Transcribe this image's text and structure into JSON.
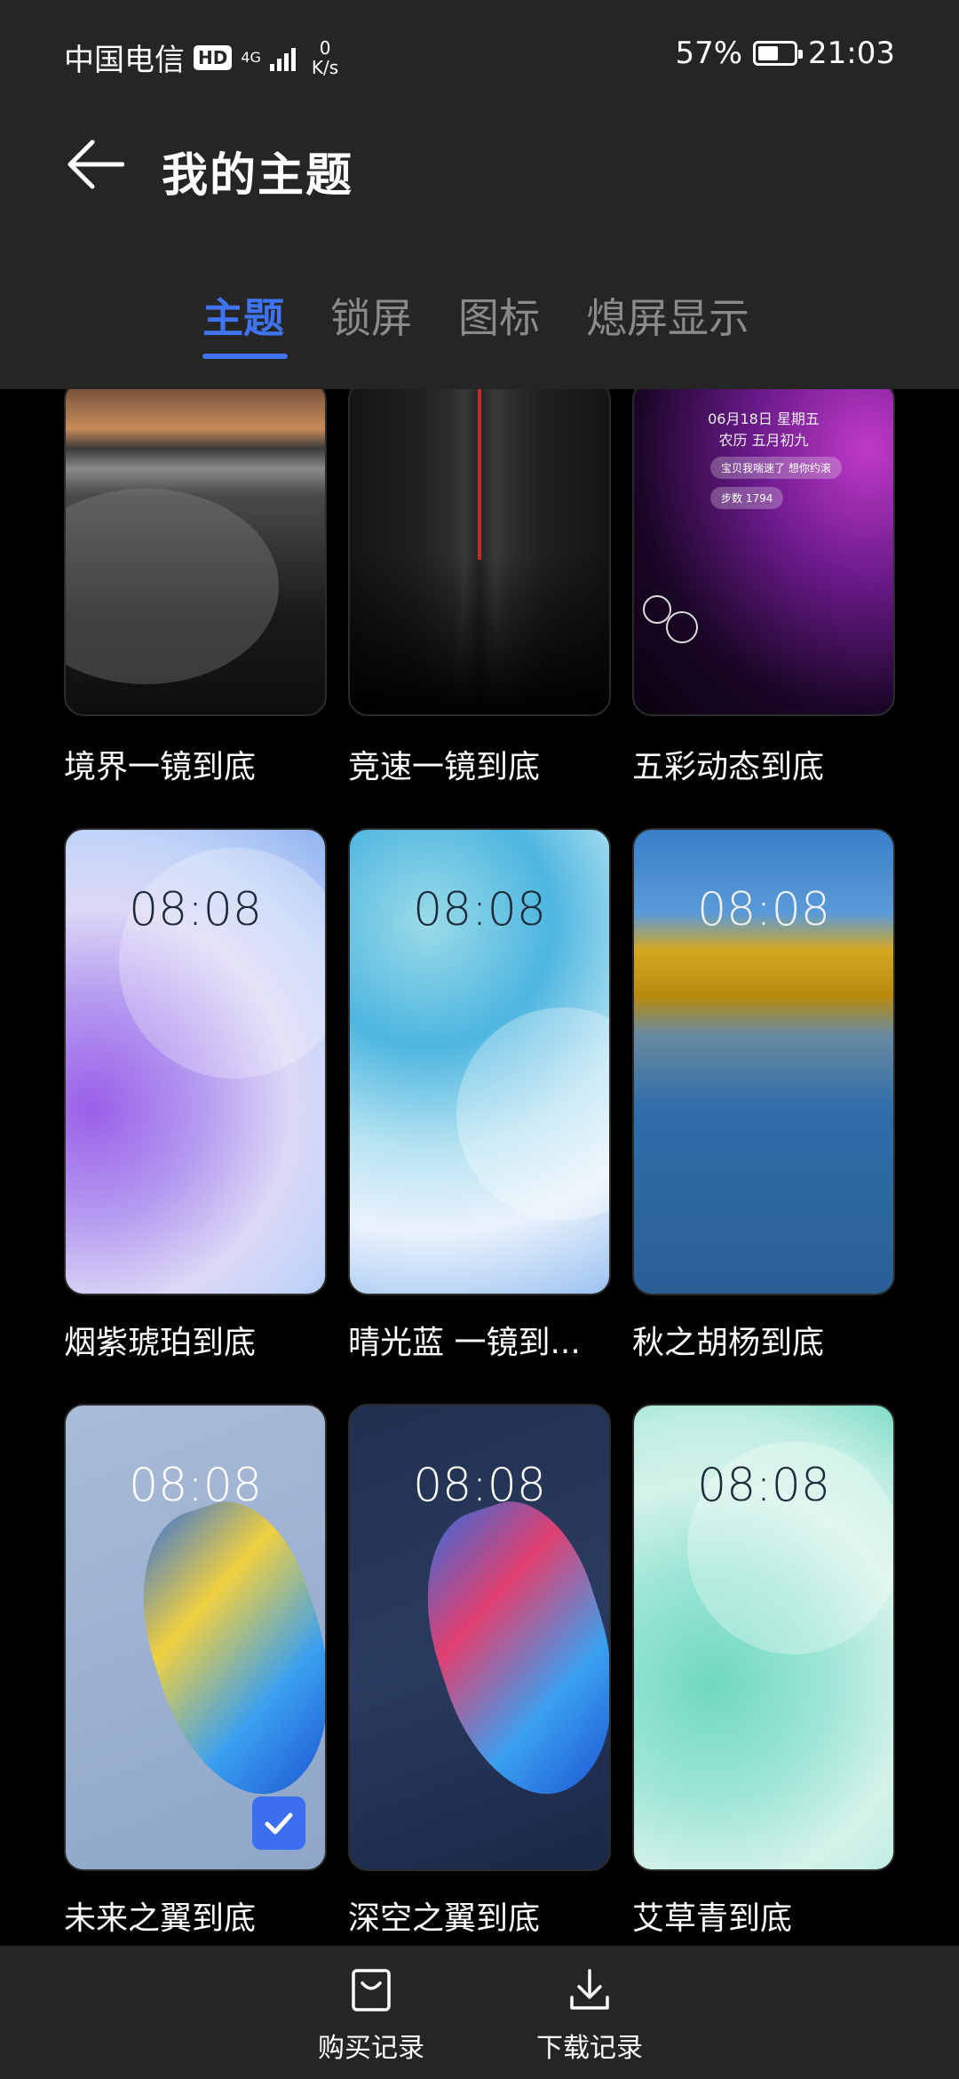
{
  "status_bar": {
    "carrier": "中国电信",
    "hd": "HD",
    "network": "4G",
    "speed_value": "0",
    "speed_unit": "K/s",
    "battery_percent": "57%",
    "battery_level": 0.57,
    "time": "21:03"
  },
  "header": {
    "back_icon": "arrow-left-icon",
    "title": "我的主题"
  },
  "tabs": [
    {
      "label": "主题",
      "active": true
    },
    {
      "label": "锁屏",
      "active": false
    },
    {
      "label": "图标",
      "active": false
    },
    {
      "label": "熄屏显示",
      "active": false
    }
  ],
  "themes": [
    {
      "name": "境界一镜到底",
      "clock": ""
    },
    {
      "name": "竞速一镜到底",
      "clock": ""
    },
    {
      "name": "五彩动态到底",
      "clock": "",
      "preview_date": "06月18日 星期五",
      "preview_lunar": "农历 五月初九",
      "preview_bubble1": "宝贝我喘速了 想你约滚",
      "preview_bubble2": "步数 1794"
    },
    {
      "name": "烟紫琥珀到底",
      "clock": "08:08"
    },
    {
      "name": "晴光蓝 一镜到...",
      "clock": "08:08"
    },
    {
      "name": "秋之胡杨到底",
      "clock": "08:08"
    },
    {
      "name": "未来之翼到底",
      "clock": "08:08",
      "selected": true
    },
    {
      "name": "深空之翼到底",
      "clock": "08:08"
    },
    {
      "name": "艾草青到底",
      "clock": "08:08"
    }
  ],
  "bottom_bar": {
    "purchase_label": "购买记录",
    "purchase_icon": "shopping-bag-icon",
    "download_label": "下载记录",
    "download_icon": "download-icon"
  },
  "colors": {
    "accent": "#3f73f0",
    "header_bg": "#252525",
    "page_bg": "#000000"
  }
}
